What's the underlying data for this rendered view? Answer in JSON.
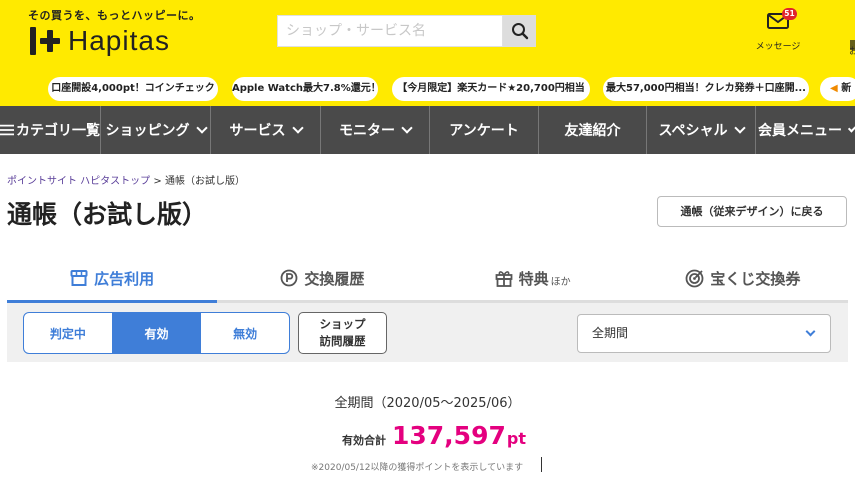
{
  "header": {
    "tagline": "その買うを、もっとハッピーに。",
    "logo_text": "Hapitas",
    "search_placeholder": "ショップ・サービス名",
    "message_label": "メッセージ",
    "message_count": "51"
  },
  "campaigns": [
    "口座開設4,000pt！コインチェック",
    "Apple Watch最大7.8%還元！",
    "【今月限定】楽天カード★20,700円相当",
    "最大57,000円相当！クレカ発券＋口座開...",
    "新"
  ],
  "nav": [
    {
      "label": "カテゴリ一覧",
      "has_chevron": false
    },
    {
      "label": "ショッピング",
      "has_chevron": true
    },
    {
      "label": "サービス",
      "has_chevron": true
    },
    {
      "label": "モニター",
      "has_chevron": true
    },
    {
      "label": "アンケート",
      "has_chevron": false
    },
    {
      "label": "友達紹介",
      "has_chevron": false
    },
    {
      "label": "スペシャル",
      "has_chevron": true
    },
    {
      "label": "会員メニュー",
      "has_chevron": true
    }
  ],
  "breadcrumb": {
    "home": "ポイントサイト ハピタストップ",
    "separator": ">",
    "current": "通帳（お試し版）"
  },
  "page": {
    "title": "通帳（お試し版）",
    "classic_button": "通帳（従来デザイン）に戻る"
  },
  "tabs": [
    {
      "label": "広告利用",
      "suffix": "",
      "icon": "storefront-icon",
      "active": true
    },
    {
      "label": "交換履歴",
      "suffix": "",
      "icon": "point-icon",
      "active": false
    },
    {
      "label": "特典",
      "suffix": "ほか",
      "icon": "gift-icon",
      "active": false
    },
    {
      "label": "宝くじ交換券",
      "suffix": "",
      "icon": "lottery-icon",
      "active": false
    }
  ],
  "filter": {
    "status_options": [
      "判定中",
      "有効",
      "無効"
    ],
    "selected_status": "有効",
    "shop_history_line1": "ショップ",
    "shop_history_line2": "訪問履歴",
    "period_value": "全期間"
  },
  "summary": {
    "range": "全期間（2020/05〜2025/06）",
    "total_label": "有効合計",
    "total_value": "137,597",
    "unit": "pt",
    "note": "※2020/05/12以降の獲得ポイントを表示しています"
  },
  "colors": {
    "header_yellow": "#ffea00",
    "nav_gray": "#4a4a4a",
    "accent_blue": "#3f7ed8",
    "points_pink": "#e4007f"
  }
}
